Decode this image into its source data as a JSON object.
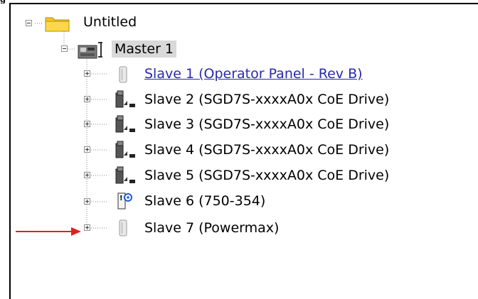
{
  "header": {
    "caption": "g"
  },
  "tree": {
    "root": {
      "label": "Untitled",
      "icon": "folder-icon"
    },
    "master": {
      "label": "Master 1",
      "icon": "ethercat-master-icon"
    },
    "slaves": [
      {
        "label": "Slave 1 (Operator Panel - Rev B)",
        "icon": "generic-device-icon",
        "hyperlink": true
      },
      {
        "label": "Slave 2 (SGD7S-xxxxA0x CoE Drive)",
        "icon": "servo-drive-icon"
      },
      {
        "label": "Slave 3 (SGD7S-xxxxA0x CoE Drive)",
        "icon": "servo-drive-icon"
      },
      {
        "label": "Slave 4 (SGD7S-xxxxA0x CoE Drive)",
        "icon": "servo-drive-icon"
      },
      {
        "label": "Slave 5 (SGD7S-xxxxA0x CoE Drive)",
        "icon": "servo-drive-icon"
      },
      {
        "label": "Slave 6 (750-354)",
        "icon": "io-coupler-icon"
      },
      {
        "label": "Slave 7 (Powermax)",
        "icon": "generic-device-icon"
      }
    ]
  },
  "colors": {
    "link": "#2a2aa8",
    "arrow": "#e02020",
    "selected_bg": "#d9d9d9"
  }
}
